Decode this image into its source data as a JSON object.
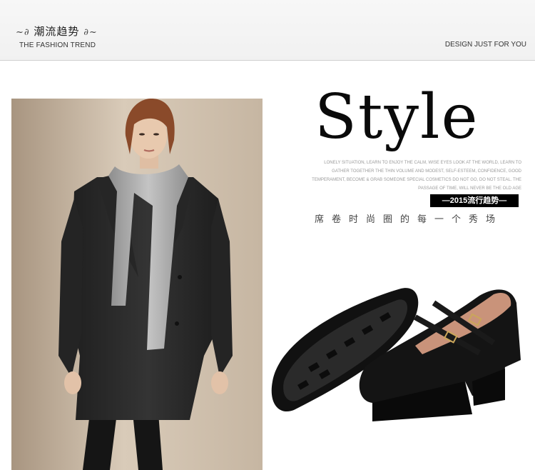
{
  "header": {
    "title_cn": "潮流趋势",
    "title_en": "THE FASHION TREND",
    "tagline": "DESIGN JUST FOR YOU"
  },
  "hero": {
    "style_word": "Style",
    "description": "LONELY SITUATION, LEARN TO ENJOY THE CALM, WISE EYES LOOK AT THE WORLD, LEARN TO GATHER TOGETHER THE THIN VOLUME AND MODEST, SELF-ESTEEM, CONFIDENCE, GOOD TEMPERAMENT, BECOME & GRAB SOMEONE SPECIAL COSMETICS DO NOT GO, DO NOT STEAL. THE PASSAGE OF TIME, WILL NEVER BE THE OLD AGE",
    "year_badge": "—2015流行趋势—",
    "slogan": "席卷时尚圈的每一个秀场"
  },
  "colors": {
    "accent": "#000000",
    "header_bg": "#f3f3f3",
    "coat": "#2b2b2b",
    "scarf": "#a9a9a9",
    "photo_bg": "#cfc1b0",
    "shoe_lining": "#c9937a"
  }
}
